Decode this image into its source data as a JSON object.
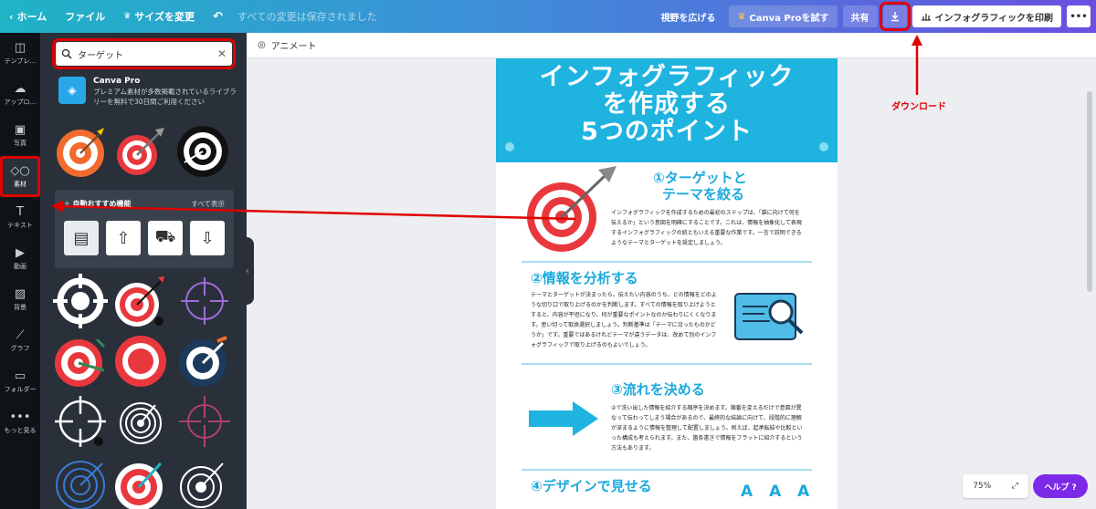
{
  "topbar": {
    "home": "ホーム",
    "file": "ファイル",
    "resize": "サイズを変更",
    "saved_status": "すべての変更は保存されました",
    "expand_view": "視野を広げる",
    "try_pro": "Canva Proを試す",
    "share": "共有",
    "print": "インフォグラフィックを印刷"
  },
  "rail": {
    "items": [
      {
        "label": "テンプレ…",
        "icon": "template-icon"
      },
      {
        "label": "アップロ…",
        "icon": "upload-icon"
      },
      {
        "label": "写真",
        "icon": "photo-icon"
      },
      {
        "label": "素材",
        "icon": "elements-icon"
      },
      {
        "label": "テキスト",
        "icon": "text-icon"
      },
      {
        "label": "動画",
        "icon": "video-icon"
      },
      {
        "label": "背景",
        "icon": "background-icon"
      },
      {
        "label": "グラフ",
        "icon": "chart-icon"
      },
      {
        "label": "フォルダー",
        "icon": "folder-icon"
      },
      {
        "label": "もっと見る",
        "icon": "more-icon"
      }
    ]
  },
  "panel": {
    "search_value": "ターゲット",
    "promo_title": "Canva Pro",
    "promo_desc": "プレミアム素材が多数掲載されているライブラリーを無料で30日間ご利用ください",
    "auto_title": "自動おすすめ機能",
    "auto_all": "すべて表示"
  },
  "editor": {
    "animate": "アニメート",
    "download_caption": "ダウンロード",
    "zoom": "75%",
    "help": "ヘルプ ?"
  },
  "design": {
    "hero_lines": [
      "インフォグラフィック",
      "を作成する",
      "5つのポイント"
    ],
    "sec1_title_1": "①ターゲットと",
    "sec1_title_2": "テーマを絞る",
    "sec1_body": "インフォグラフィックを作成するための最初のステップは、「誰に向けて何を伝えるか」という意図を明確にすることです。これは、情報を抽象化して表現するインフォグラフィックの統ともいえる重要な作業です。一言で説明できるようなテーマとターゲットを設定しましょう。",
    "sec2_title": "②情報を分析する",
    "sec2_body": "テーマとターゲットが決まったら、伝えたい内容のうち、どの情報をどのような切り口で取り上げるのかを判断します。すべての情報を取り上げようとすると、内容が平坦になり、何が重要なポイントなのか伝わりにくくなります。思い切って取捨選択しましょう。判断基準は「テーマに沿ったものかどうか」です。重要ではあるけれどテーマが違うデータは、改めて別のインフォグラフィックで取り上げるのもよいでしょう。",
    "sec3_title": "③流れを決める",
    "sec3_body": "②で洗い出した情報を紹介する順序を決めます。順番を変えるだけで意図が異なって伝わってしまう場合があるので、最終的な結論に向けて、段階的に理解が深まるように情報を整理して配置しましょう。例えば、起承転結や比較といった構成も考えられます。また、箇条書きで情報をフラットに紹介するという方法もあります。",
    "sec4_title": "④デザインで見せる",
    "sec4_sample": "A A A"
  },
  "colors": {
    "accent": "#1fb3e0",
    "target_red": "#e8383d",
    "highlight": "#e00000",
    "help_purple": "#7d2ae8"
  }
}
